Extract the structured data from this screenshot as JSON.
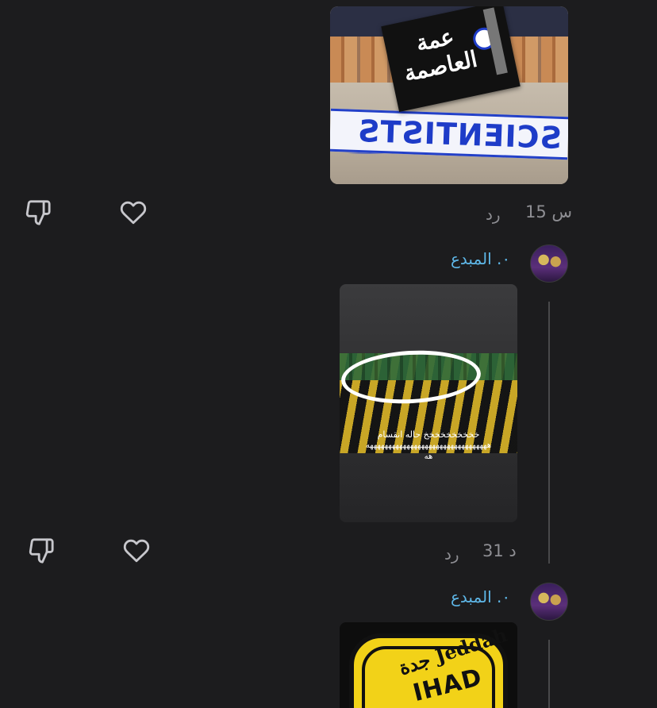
{
  "posts": [
    {
      "image_banner_text": "SCIENTISTS",
      "image_sticker_text": "عمة العاصمة",
      "timestamp": "15 س",
      "reply_label": "رد"
    },
    {
      "username": "٠. المبدع",
      "image_caption_line1": "خخخخخخخخخخ حاله انقسام",
      "image_caption_line2": "هههههههههههههههههههههههههههههههههه",
      "image_caption_line3": "هه",
      "timestamp": "31 د",
      "reply_label": "رد"
    },
    {
      "username": "٠. المبدع",
      "image_text_top": "جدة Jeddah",
      "image_text_main": "IHAD"
    }
  ],
  "icons": {
    "dislike": "thumbs-down-icon",
    "like": "heart-icon"
  }
}
